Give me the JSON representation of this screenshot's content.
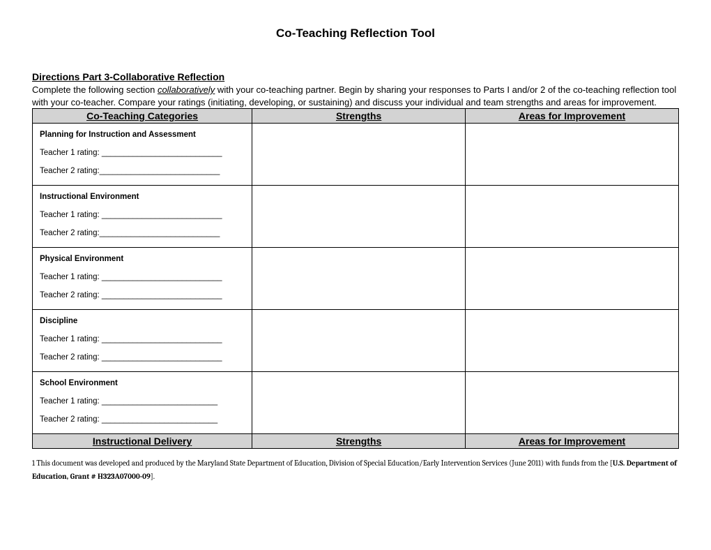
{
  "title": "Co-Teaching Reflection Tool",
  "directions": {
    "heading": "Directions Part 3-Collaborative Reflection",
    "text_pre": "Complete the following section ",
    "emph": "collaboratively",
    "text_post": " with your co-teaching partner. Begin by sharing your responses to Parts I and/or 2 of the co-teaching reflection tool with your co-teacher.  Compare your ratings (initiating, developing, or sustaining) and discuss your individual and team strengths and areas for improvement."
  },
  "table": {
    "header1": {
      "col1": "Co-Teaching Categories",
      "col2": "Strengths",
      "col3": "Areas for Improvement"
    },
    "rows": [
      {
        "category": "Planning for Instruction and Assessment",
        "t1": "Teacher 1 rating: ___________________________",
        "t2": "Teacher 2 rating:___________________________"
      },
      {
        "category": "Instructional Environment",
        "t1": "Teacher 1 rating: ___________________________",
        "t2": "Teacher 2  rating:___________________________"
      },
      {
        "category": "Physical Environment",
        "t1": "Teacher 1  rating: ___________________________",
        "t2": "Teacher 2  rating: ___________________________"
      },
      {
        "category": "Discipline",
        "t1": "Teacher 1  rating: ___________________________",
        "t2": "Teacher 2  rating: ___________________________"
      },
      {
        "category": "School Environment",
        "t1": "Teacher 1  rating: __________________________",
        "t2": "Teacher 2  rating: __________________________"
      }
    ],
    "header2": {
      "col1": "Instructional Delivery",
      "col2": "Strengths",
      "col3": "Areas for Improvement"
    }
  },
  "footnote": {
    "num": "1",
    "text1": " This document was developed and produced by the Maryland State Department of Education, Division of Special Education/Early Intervention Services (June 2011) with funds from the [",
    "bold": "U.S. Department of Education, Grant # H323A07000-09",
    "text2": "]."
  }
}
